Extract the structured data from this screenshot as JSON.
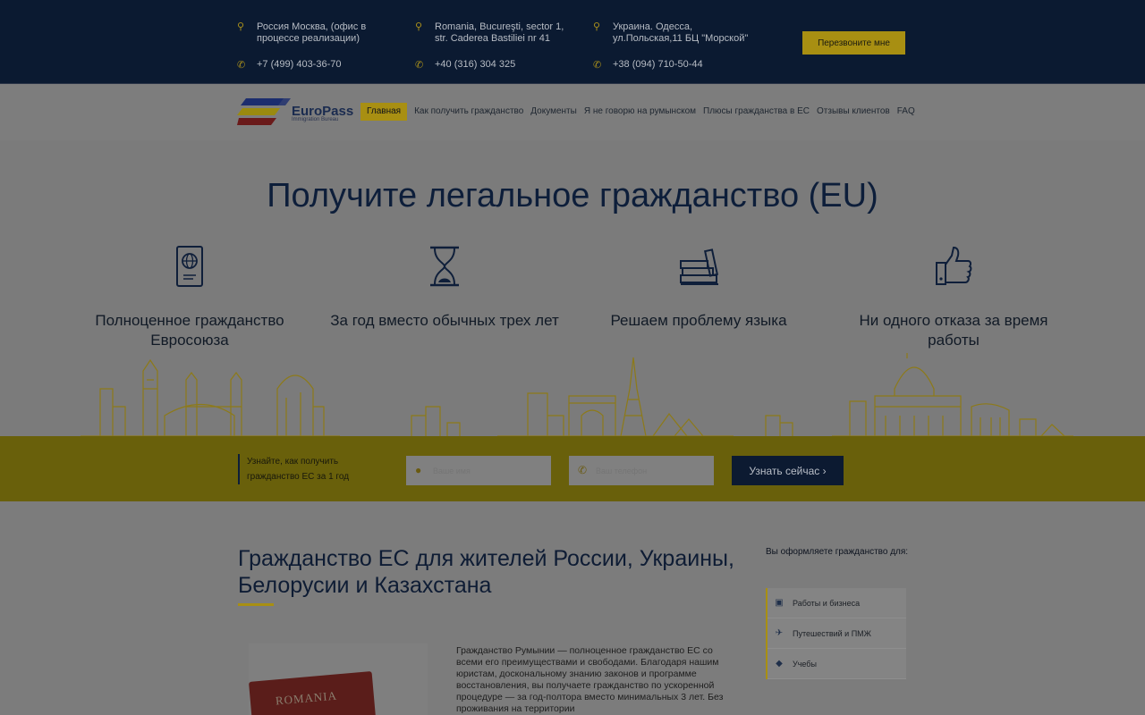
{
  "topbar": {
    "contacts": [
      {
        "address": "Россия Москва, (офис в процессе реализации)",
        "phone": "+7 (499) 403-36-70"
      },
      {
        "address": "Romania, Bucureşti, sector 1, str. Caderea Bastiliei nr 41",
        "phone": "+40 (316) 304 325"
      },
      {
        "address": "Украина. Одесса, ул.Польская,11 БЦ \"Морской\"",
        "phone": "+38 (094) 710-50-44"
      }
    ],
    "callback_label": "Перезвоните мне"
  },
  "logo": {
    "title": "EuroPass",
    "subtitle": "Immigration Bureau"
  },
  "nav": {
    "items": [
      {
        "label": "Главная"
      },
      {
        "label": "Как получить гражданство"
      },
      {
        "label": "Документы"
      },
      {
        "label": "Я не говорю на румынском"
      },
      {
        "label": "Плюсы гражданства в ЕС"
      },
      {
        "label": "Отзывы клиентов"
      },
      {
        "label": "FAQ"
      }
    ]
  },
  "hero": {
    "title": "Получите легальное гражданство (EU)",
    "features": [
      {
        "label": "Полноценное гражданство Евросоюза",
        "icon": "passport-icon"
      },
      {
        "label": "За год вместо обычных трех лет",
        "icon": "hourglass-icon"
      },
      {
        "label": "Решаем проблему языка",
        "icon": "books-icon"
      },
      {
        "label": "Ни одного отказа за время работы",
        "icon": "thumbs-up-icon"
      }
    ]
  },
  "form": {
    "text": "Узнайте, как получить гражданство ЕС за 1 год",
    "name_placeholder": "Ваше имя",
    "phone_placeholder": "Ваш телефон",
    "submit_label": "Узнать сейчас ›"
  },
  "content": {
    "title": "Гражданство ЕС для жителей России, Украины, Белорусии и Казахстана",
    "passport_label": "ROMANIA",
    "text": "Гражданство Румынии — полноценное гражданство ЕС со всеми его преимуществами и свободами. Благодаря нашим юристам, доскональному знанию законов и программе восстановления, вы получаете гражданство по ускоренной процедуре — за год-полтора вместо минимальных 3 лет. Без проживания на территории"
  },
  "sidebar": {
    "title": "Вы оформляете гражданство для:",
    "items": [
      {
        "label": "Работы и бизнеса",
        "icon": "wallet-icon"
      },
      {
        "label": "Путешествий и ПМЖ",
        "icon": "airplane-icon"
      },
      {
        "label": "Учебы",
        "icon": "graduation-cap-icon"
      }
    ]
  },
  "colors": {
    "accent": "#a88f12",
    "dark_navy": "#0b1a31"
  }
}
